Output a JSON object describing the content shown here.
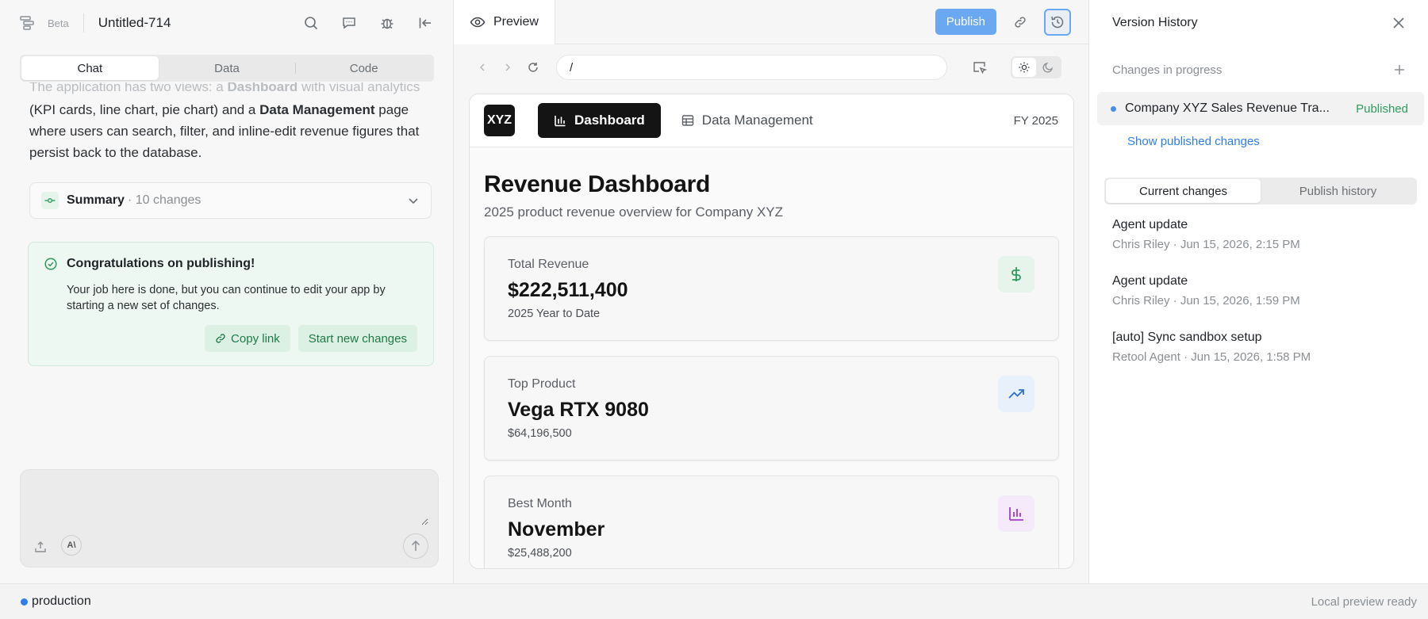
{
  "header": {
    "beta": "Beta",
    "app_title": "Untitled-714"
  },
  "left_tabs": [
    "Chat",
    "Data",
    "Code"
  ],
  "chat": {
    "line1_faded_a": "The application has two views: a ",
    "line1_faded_b": "Dashboard",
    "line1_faded_c": " with visual analytics",
    "p_a": "(KPI cards, line chart, pie chart) and a ",
    "p_b": "Data Management",
    "p_c": " page where users can search, filter, and inline-edit revenue figures that persist back to the database."
  },
  "summary": {
    "label": "Summary",
    "count": "· 10 changes"
  },
  "congrats": {
    "title": "Congratulations on publishing!",
    "body": "Your job here is done, but you can continue to edit your app by starting a new set of changes.",
    "copy_link": "Copy link",
    "start_new": "Start new changes"
  },
  "composer": {
    "placeholder": "",
    "ai_badge": "A\\"
  },
  "preview": {
    "tab_label": "Preview",
    "publish": "Publish",
    "url": "/"
  },
  "app": {
    "logo": "XYZ",
    "nav_dashboard": "Dashboard",
    "nav_data": "Data Management",
    "fy": "FY 2025",
    "title": "Revenue Dashboard",
    "subtitle": "2025 product revenue overview for Company XYZ",
    "kpis": [
      {
        "label": "Total Revenue",
        "value": "$222,511,400",
        "note": "2025 Year to Date",
        "icon": "dollar-icon",
        "color": "#2e9b5f",
        "bg": "#e6f4ec"
      },
      {
        "label": "Top Product",
        "value": "Vega RTX 9080",
        "note": "$64,196,500",
        "icon": "trending-up-icon",
        "color": "#2f6fd6",
        "bg": "#e8f0fb"
      },
      {
        "label": "Best Month",
        "value": "November",
        "note": "$25,488,200",
        "icon": "bar-chart-icon",
        "color": "#a43bd6",
        "bg": "#f4eaf9"
      }
    ]
  },
  "version_history": {
    "title": "Version History",
    "section": "Changes in progress",
    "item_name": "Company XYZ Sales Revenue Tra...",
    "item_status": "Published",
    "show_changes": "Show published changes",
    "tabs": [
      "Current changes",
      "Publish history"
    ],
    "entries": [
      {
        "title": "Agent update",
        "meta": "Chris Riley · Jun 15, 2026, 2:15 PM"
      },
      {
        "title": "Agent update",
        "meta": "Chris Riley · Jun 15, 2026, 1:59 PM"
      },
      {
        "title": "[auto] Sync sandbox setup",
        "meta": "Retool Agent · Jun 15, 2026, 1:58 PM"
      }
    ]
  },
  "status": {
    "env": "production",
    "right": "Local preview ready"
  },
  "colors": {
    "accent": "#6aa8f2",
    "success": "#2e9b5f",
    "link": "#2f7ee8"
  }
}
